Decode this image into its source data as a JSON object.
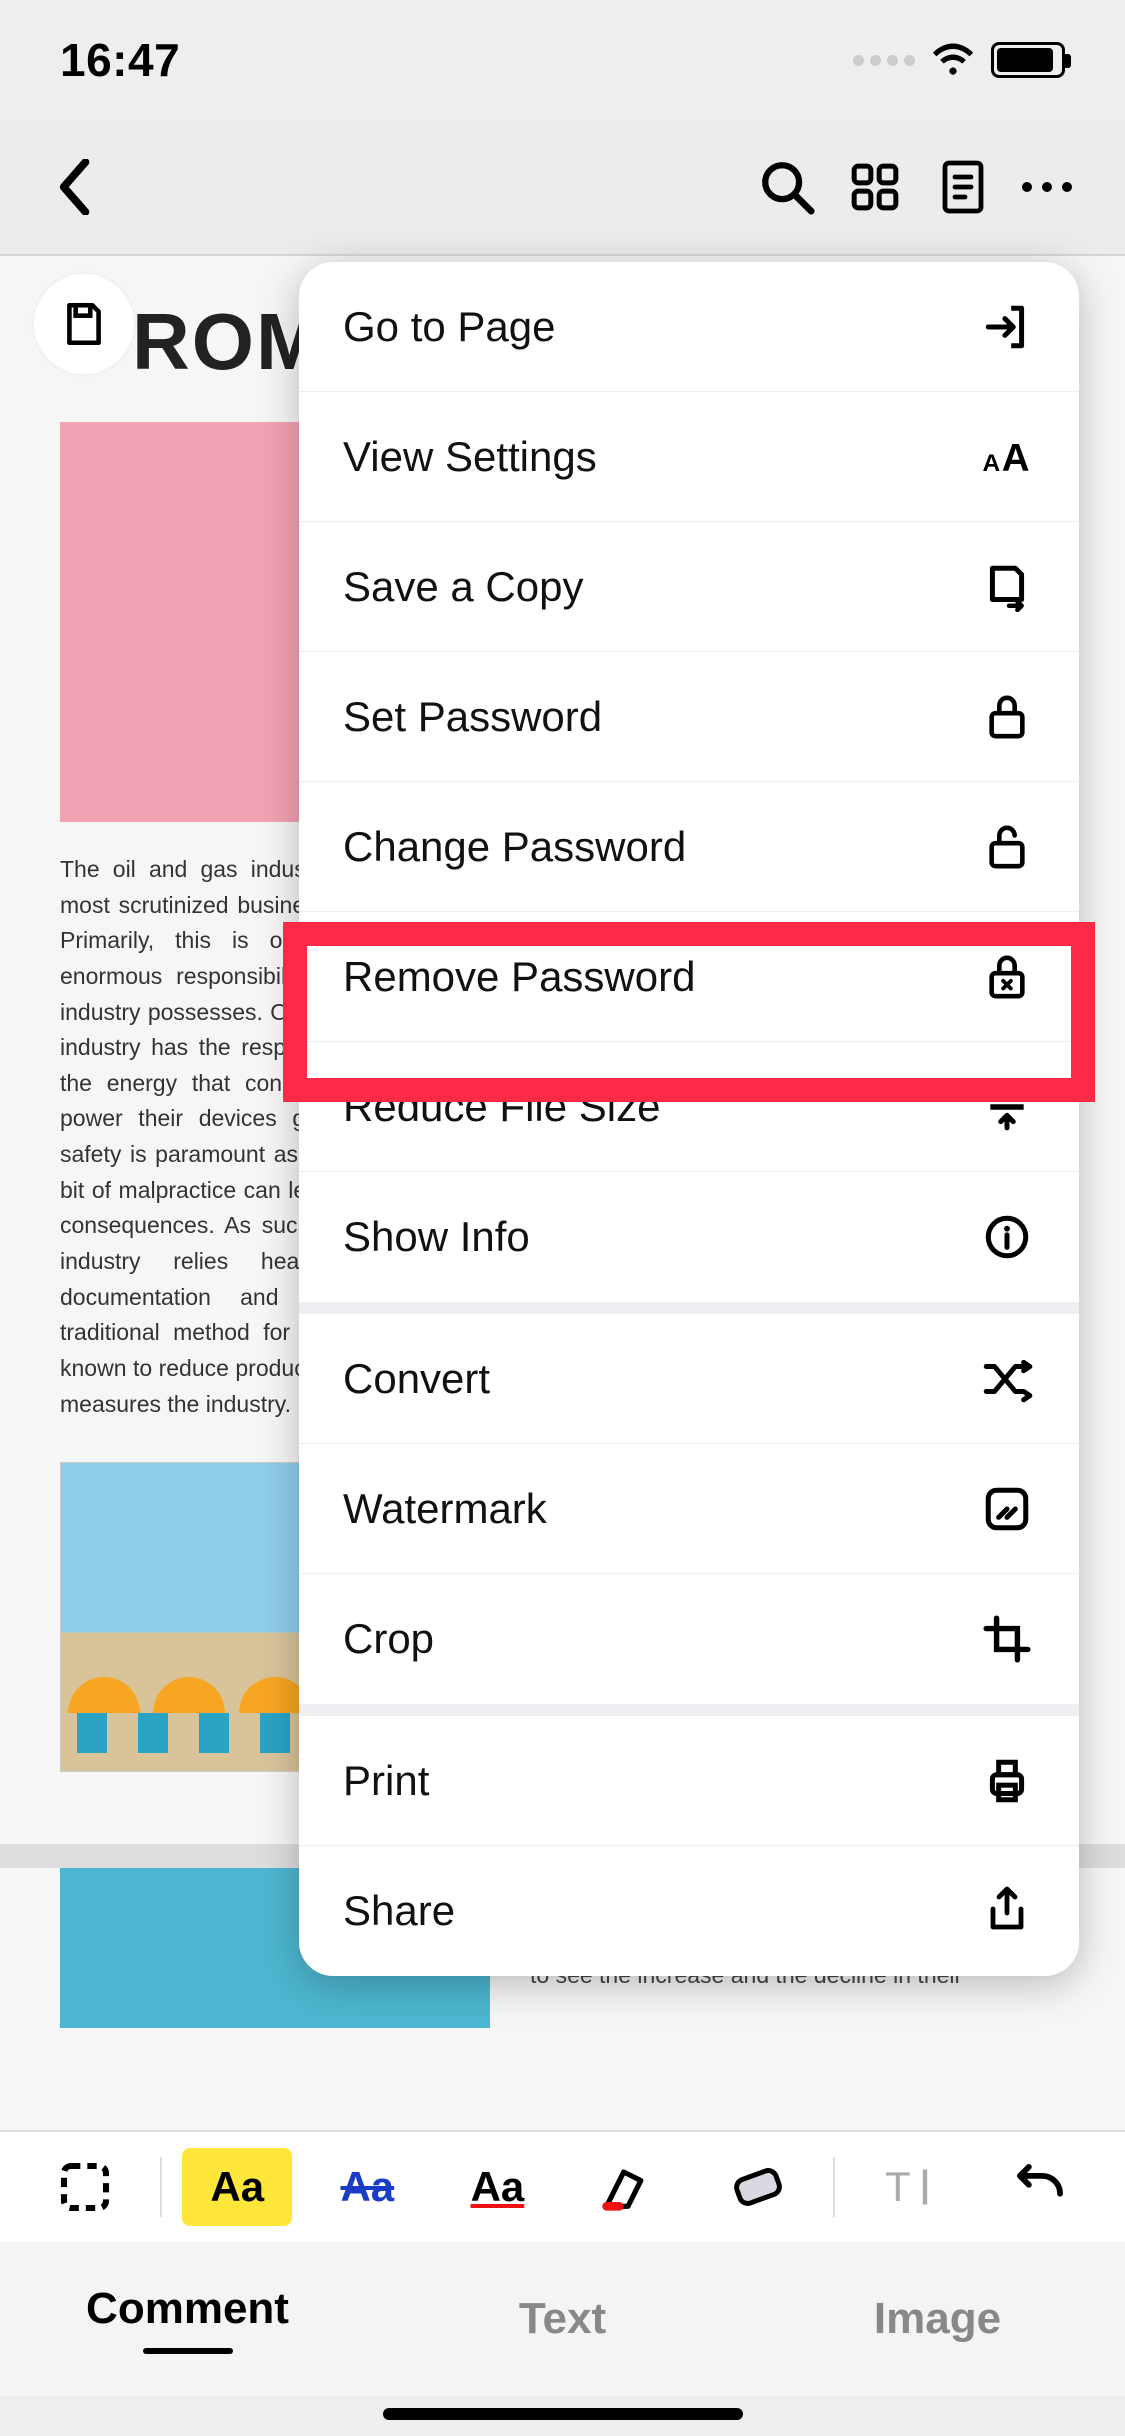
{
  "status": {
    "time": "16:47"
  },
  "doc": {
    "heading": "ROM",
    "paragraph": "The oil and gas industry is one of the most scrutinized businesses in the world. Primarily, this is on account of the enormous responsibility and liability the industry possesses. On the one hand, the industry has the responsibility to provide the energy that consumers will use to power their devices globally. Secondly, safety is paramount as even the slightest bit of malpractice can lead to catastrophic consequences. As such, the oil and gas industry relies heavily on proper documentation and paperwork. The traditional method for this paperwork is known to reduce productivity and by some measures the industry.",
    "caption2": "to see the increase and the decline in their"
  },
  "menu": {
    "go_to_page": "Go to Page",
    "view_settings": "View Settings",
    "save_copy": "Save a Copy",
    "set_password": "Set Password",
    "change_password": "Change Password",
    "remove_password": "Remove Password",
    "reduce_file_size": "Reduce File Size",
    "show_info": "Show Info",
    "convert": "Convert",
    "watermark": "Watermark",
    "crop": "Crop",
    "print": "Print",
    "share": "Share"
  },
  "tools": {
    "highlight": "Aa",
    "strike": "Aa",
    "underline": "Aa",
    "text_insert": "T"
  },
  "tabs": {
    "comment": "Comment",
    "text": "Text",
    "image": "Image"
  }
}
